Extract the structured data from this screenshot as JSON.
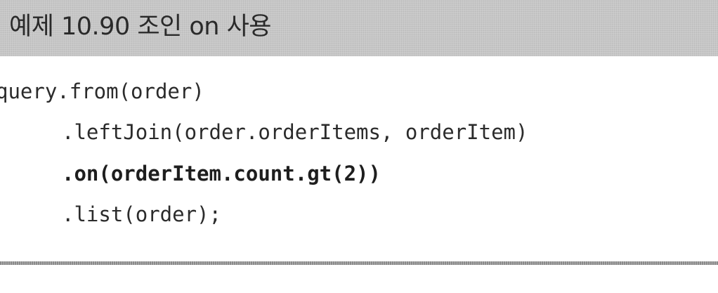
{
  "example": {
    "title": "예제 10.90 조인 on 사용"
  },
  "code": {
    "lines": [
      "query.from(order)",
      ".leftJoin(order.orderItems, orderItem)",
      ".on(orderItem.count.gt(2))",
      ".list(order);"
    ]
  },
  "colors": {
    "title_background": "#cfcfcf",
    "text": "#2b2b2b",
    "rule": "#8a8a8a"
  }
}
